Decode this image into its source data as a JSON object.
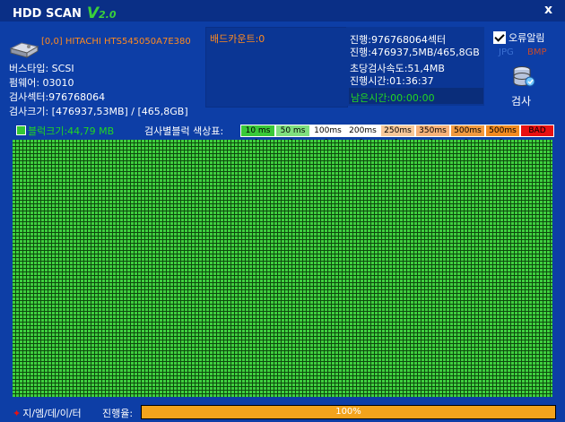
{
  "title": {
    "app": "HDD SCAN",
    "version_v": "V",
    "version_num": "2.0"
  },
  "close_label": "x",
  "disk": {
    "name": "[0,0] HITACHI HTS545050A7E380",
    "bus_type": "버스타입: SCSI",
    "firmware": "펌웨어: 03010",
    "scan_sectors": "검사섹터:976768064",
    "scan_size": "검사크기: [476937,53MB] / [465,8GB]"
  },
  "bad_count": "배드카운트:0",
  "progress_info": {
    "progress_sectors": "진행:976768064섹터",
    "progress_size": "진행:476937,5MB/465,8GB",
    "speed": "초당검사속도:51,4MB",
    "elapsed": "진행시간:01:36:37",
    "remaining": "남은시간:00:00:00"
  },
  "options": {
    "error_alarm": "오류알림",
    "jpg": "JPG",
    "bmp": "BMP",
    "scan_button": "검사"
  },
  "block_size": "블럭크기:44,79 MB",
  "legend_title": "검사별블럭 색상표:",
  "legend": [
    {
      "label": "10 ms >",
      "color": "#39c939"
    },
    {
      "label": "50 ms >",
      "color": "#7fe07f"
    },
    {
      "label": "100ms >",
      "color": "#ffffff"
    },
    {
      "label": "200ms >",
      "color": "#ffffff"
    },
    {
      "label": "250ms >",
      "color": "#f7c89a"
    },
    {
      "label": "350ms >",
      "color": "#f7b27a"
    },
    {
      "label": "500ms >",
      "color": "#f29a40"
    },
    {
      "label": "500ms >",
      "color": "#f28a20"
    },
    {
      "label": "BAD",
      "color": "#e81010"
    }
  ],
  "footer": {
    "brand": "지/엠/데/이/터",
    "progress_label": "진행율:",
    "progress_text": "100%",
    "progress_value": 1.0
  }
}
